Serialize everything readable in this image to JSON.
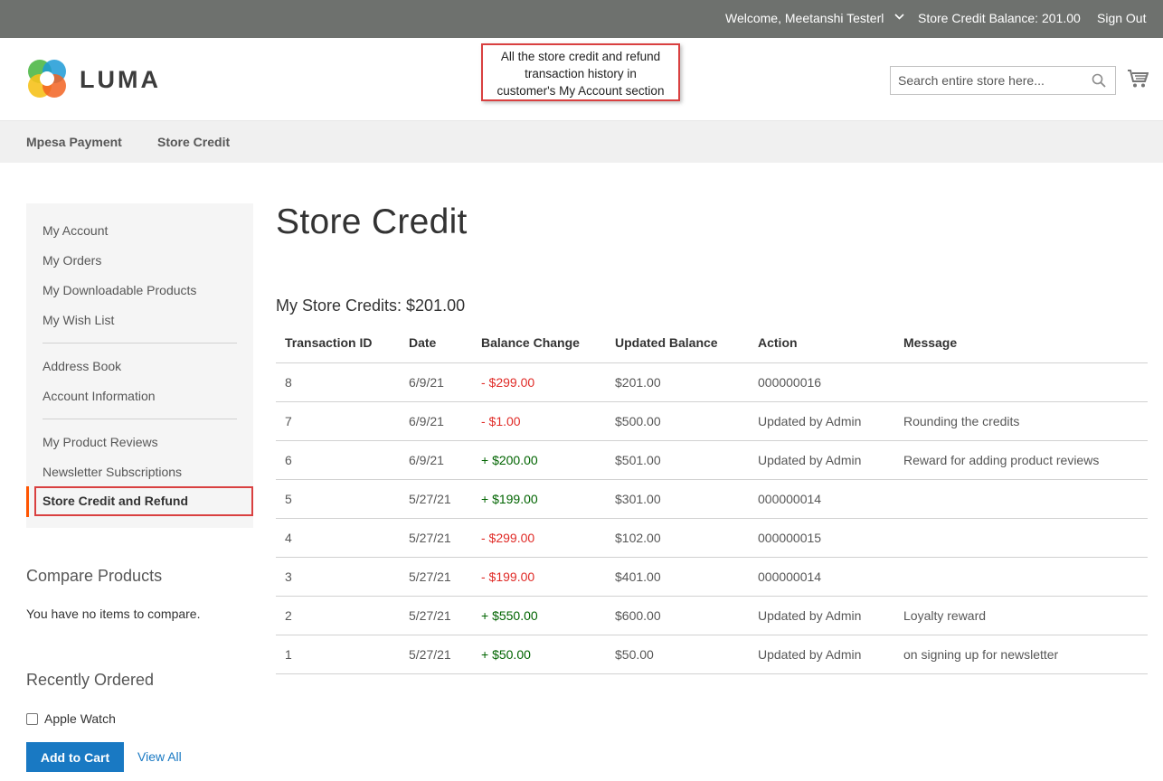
{
  "topbar": {
    "welcome": "Welcome, Meetanshi Testerl",
    "balance": "Store Credit Balance: 201.00",
    "signout": "Sign Out"
  },
  "header": {
    "logo_text": "LUMA",
    "callout_lines": [
      "All the store credit and refund",
      "transaction history in",
      "customer's My Account section"
    ],
    "search_placeholder": "Search entire store here..."
  },
  "nav": {
    "items": [
      "Mpesa Payment",
      "Store Credit"
    ]
  },
  "sidebar": {
    "group1": [
      "My Account",
      "My Orders",
      "My Downloadable Products",
      "My Wish List"
    ],
    "group2": [
      "Address Book",
      "Account Information"
    ],
    "group3": [
      "My Product Reviews",
      "Newsletter Subscriptions"
    ],
    "active": "Store Credit and Refund"
  },
  "compare": {
    "title": "Compare Products",
    "text": "You have no items to compare."
  },
  "recent": {
    "title": "Recently Ordered",
    "item": "Apple Watch",
    "add_button": "Add to Cart",
    "view_all": "View All"
  },
  "main": {
    "title": "Store Credit",
    "credits": "My Store Credits: $201.00",
    "columns": [
      "Transaction ID",
      "Date",
      "Balance Change",
      "Updated Balance",
      "Action",
      "Message"
    ],
    "rows": [
      {
        "id": "8",
        "date": "6/9/21",
        "change": "- $299.00",
        "updated": "$201.00",
        "action": "000000016",
        "message": ""
      },
      {
        "id": "7",
        "date": "6/9/21",
        "change": "- $1.00",
        "updated": "$500.00",
        "action": "Updated by Admin",
        "message": "Rounding the credits"
      },
      {
        "id": "6",
        "date": "6/9/21",
        "change": "+ $200.00",
        "updated": "$501.00",
        "action": "Updated by Admin",
        "message": "Reward for adding product reviews"
      },
      {
        "id": "5",
        "date": "5/27/21",
        "change": "+ $199.00",
        "updated": "$301.00",
        "action": "000000014",
        "message": ""
      },
      {
        "id": "4",
        "date": "5/27/21",
        "change": "- $299.00",
        "updated": "$102.00",
        "action": "000000015",
        "message": ""
      },
      {
        "id": "3",
        "date": "5/27/21",
        "change": "- $199.00",
        "updated": "$401.00",
        "action": "000000014",
        "message": ""
      },
      {
        "id": "2",
        "date": "5/27/21",
        "change": "+ $550.00",
        "updated": "$600.00",
        "action": "Updated by Admin",
        "message": "Loyalty reward"
      },
      {
        "id": "1",
        "date": "5/27/21",
        "change": "+ $50.00",
        "updated": "$50.00",
        "action": "Updated by Admin",
        "message": "on signing up for newsletter"
      }
    ]
  },
  "colors": {
    "topbar": "#6e716e",
    "accent": "#1979c3",
    "negative": "#e02b27",
    "positive": "#006400",
    "highlight": "#d94040",
    "active_bar": "#ff5501"
  }
}
